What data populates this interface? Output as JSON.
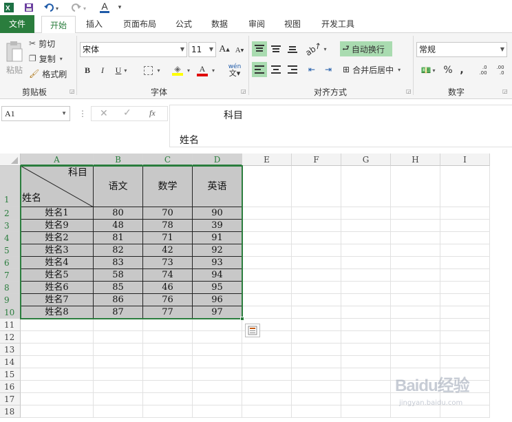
{
  "titlebar": {
    "app_icon": "excel-icon",
    "font_color_letter": "A"
  },
  "tabs": {
    "file": "文件",
    "items": [
      "开始",
      "插入",
      "页面布局",
      "公式",
      "数据",
      "审阅",
      "视图",
      "开发工具"
    ],
    "active": "开始"
  },
  "ribbon": {
    "clipboard": {
      "paste": "粘贴",
      "cut": "剪切",
      "copy": "复制",
      "format_painter": "格式刷",
      "label": "剪贴板"
    },
    "font": {
      "name": "宋体",
      "size": "11",
      "grow": "A",
      "shrink": "A",
      "bold": "B",
      "italic": "I",
      "underline": "U",
      "phonetic": "wén",
      "label": "字体"
    },
    "alignment": {
      "wrap_text": "自动换行",
      "merge_center": "合并后居中",
      "label": "对齐方式"
    },
    "number": {
      "format": "常规",
      "percent": "%",
      "comma": ",",
      "label": "数字",
      "inc_decimal": ".0\n.00",
      "dec_decimal": ".00\n.0"
    }
  },
  "formula_bar": {
    "name_box": "A1",
    "fx": "fx",
    "line1": "科目",
    "line2": "姓名"
  },
  "columns": [
    "A",
    "B",
    "C",
    "D",
    "E",
    "F",
    "G",
    "H",
    "I"
  ],
  "rows": [
    "1",
    "2",
    "3",
    "4",
    "5",
    "6",
    "7",
    "8",
    "9",
    "10",
    "11",
    "12",
    "13",
    "14",
    "15",
    "16",
    "17",
    "18"
  ],
  "table": {
    "corner_top": "科目",
    "corner_bottom": "姓名",
    "headers": [
      "语文",
      "数学",
      "英语"
    ],
    "data": [
      [
        "姓名1",
        "80",
        "70",
        "90"
      ],
      [
        "姓名9",
        "48",
        "78",
        "39"
      ],
      [
        "姓名2",
        "81",
        "71",
        "91"
      ],
      [
        "姓名3",
        "82",
        "42",
        "92"
      ],
      [
        "姓名4",
        "83",
        "73",
        "93"
      ],
      [
        "姓名5",
        "58",
        "74",
        "94"
      ],
      [
        "姓名6",
        "85",
        "46",
        "95"
      ],
      [
        "姓名7",
        "86",
        "76",
        "96"
      ],
      [
        "姓名8",
        "87",
        "77",
        "97"
      ]
    ]
  },
  "watermark": {
    "text": "Baidu经验",
    "sub": "jingyan.baidu.com"
  },
  "colors": {
    "accent": "#2a7d3d",
    "selection_fill": "#c8c8c8"
  }
}
